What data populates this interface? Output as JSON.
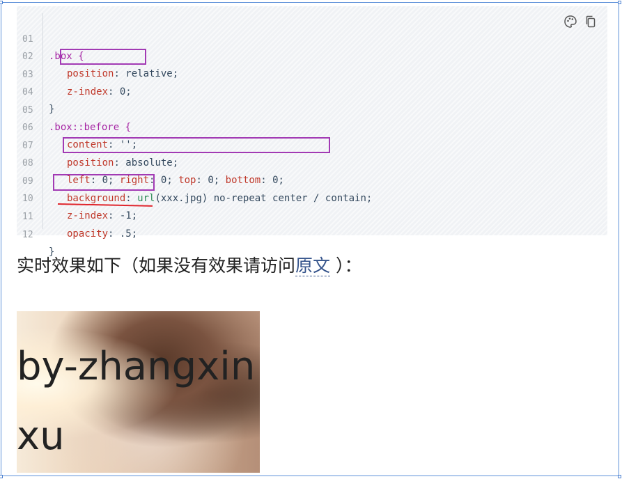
{
  "code_block": {
    "lines": [
      {
        "num": "01"
      },
      {
        "num": "02"
      },
      {
        "num": "03"
      },
      {
        "num": "04"
      },
      {
        "num": "05"
      },
      {
        "num": "06"
      },
      {
        "num": "07"
      },
      {
        "num": "08"
      },
      {
        "num": "09"
      },
      {
        "num": "10"
      },
      {
        "num": "11"
      },
      {
        "num": "12"
      }
    ],
    "tokens": {
      "l1": ".box {",
      "l2_prop": "position",
      "l2_val": ": relative;",
      "l3_prop": "z-index",
      "l3_val": ": 0;",
      "l4": "}",
      "l5": ".box::before {",
      "l6_prop": "content",
      "l6_val": ": '';",
      "l7_prop": "position",
      "l7_val": ": absolute;",
      "l8_a": "left",
      "l8_b": ": 0; ",
      "l8_c": "right",
      "l8_d": ": 0; ",
      "l8_e": "top",
      "l8_f": ": 0; ",
      "l8_g": "bottom",
      "l8_h": ": 0;",
      "l9_prop": "background",
      "l9_a": ": ",
      "l9_fn": "url",
      "l9_b": "(xxx.jpg) no-repeat center / contain;",
      "l10_prop": "z-index",
      "l10_val": ": -1;",
      "l11_prop": "opacity",
      "l11_val": ": .5;",
      "l12": "}"
    },
    "icons": [
      "palette-icon",
      "copy-icon"
    ]
  },
  "paragraph": {
    "before_link": "实时效果如下（如果没有效果请访问",
    "link": "原文",
    "after_link": " ）："
  },
  "demo": {
    "text": "by-zhangxinxu"
  }
}
